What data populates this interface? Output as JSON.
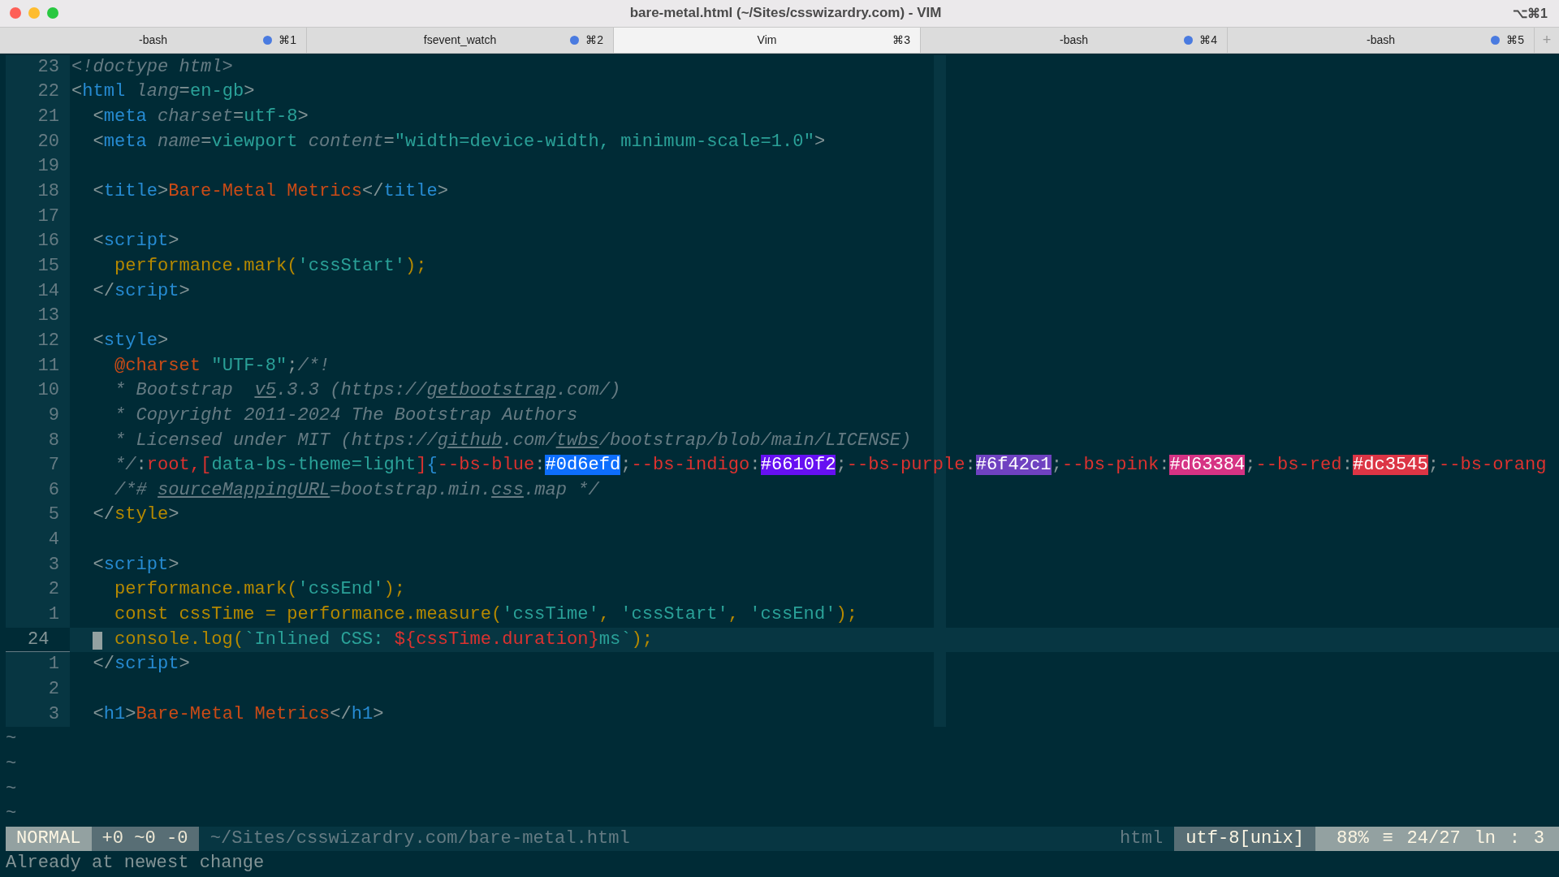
{
  "window": {
    "title": "bare-metal.html (~/Sites/csswizardry.com) - VIM",
    "shortcut": "⌥⌘1"
  },
  "tabs": [
    {
      "label": "-bash",
      "shortcut": "⌘1",
      "activity": true,
      "selected": false
    },
    {
      "label": "fsevent_watch",
      "shortcut": "⌘2",
      "activity": true,
      "selected": false
    },
    {
      "label": "Vim",
      "shortcut": "⌘3",
      "activity": false,
      "selected": true
    },
    {
      "label": "-bash",
      "shortcut": "⌘4",
      "activity": true,
      "selected": false
    },
    {
      "label": "-bash",
      "shortcut": "⌘5",
      "activity": true,
      "selected": false
    }
  ],
  "new_tab": "+",
  "lines": [
    {
      "number": "23",
      "current": false,
      "tokens": [
        {
          "kind": "doctype",
          "text": "<!doctype html>"
        }
      ]
    },
    {
      "number": "22",
      "current": false,
      "tokens": [
        {
          "kind": "punct",
          "text": "<"
        },
        {
          "kind": "tag",
          "text": "html"
        },
        {
          "kind": "attr",
          "text": " lang"
        },
        {
          "kind": "punct",
          "text": "="
        },
        {
          "kind": "value",
          "text": "en-gb"
        },
        {
          "kind": "punct",
          "text": ">"
        }
      ]
    },
    {
      "number": "21",
      "current": false,
      "tokens": [
        {
          "kind": "punct",
          "text": "  <"
        },
        {
          "kind": "tag",
          "text": "meta"
        },
        {
          "kind": "attr",
          "text": " charset"
        },
        {
          "kind": "punct",
          "text": "="
        },
        {
          "kind": "value",
          "text": "utf-8"
        },
        {
          "kind": "punct",
          "text": ">"
        }
      ]
    },
    {
      "number": "20",
      "current": false,
      "tokens": [
        {
          "kind": "punct",
          "text": "  <"
        },
        {
          "kind": "tag",
          "text": "meta"
        },
        {
          "kind": "attr",
          "text": " name"
        },
        {
          "kind": "punct",
          "text": "="
        },
        {
          "kind": "value",
          "text": "viewport"
        },
        {
          "kind": "attr",
          "text": " content"
        },
        {
          "kind": "punct",
          "text": "="
        },
        {
          "kind": "value",
          "text": "\"width=device-width, minimum-scale=1.0\""
        },
        {
          "kind": "punct",
          "text": ">"
        }
      ]
    },
    {
      "number": "19",
      "current": false
    },
    {
      "number": "18",
      "current": false,
      "tokens": [
        {
          "kind": "punct",
          "text": "  <"
        },
        {
          "kind": "tag",
          "text": "title"
        },
        {
          "kind": "punct",
          "text": ">"
        },
        {
          "kind": "text",
          "text": "Bare-Metal Metrics"
        },
        {
          "kind": "punct",
          "text": "</"
        },
        {
          "kind": "tag",
          "text": "title"
        },
        {
          "kind": "punct",
          "text": ">"
        }
      ]
    },
    {
      "number": "17",
      "current": false
    },
    {
      "number": "16",
      "current": false,
      "tokens": [
        {
          "kind": "punct",
          "text": "  <"
        },
        {
          "kind": "tag",
          "text": "script"
        },
        {
          "kind": "punct",
          "text": ">"
        }
      ]
    },
    {
      "number": "15",
      "current": false,
      "tokens": [
        {
          "kind": "call",
          "text": "    performance.mark("
        },
        {
          "kind": "string",
          "text": "'cssStart'"
        },
        {
          "kind": "call",
          "text": ");"
        }
      ]
    },
    {
      "number": "14",
      "current": false,
      "tokens": [
        {
          "kind": "punct",
          "text": "  </"
        },
        {
          "kind": "tag",
          "text": "script"
        },
        {
          "kind": "punct",
          "text": ">"
        }
      ]
    },
    {
      "number": "13",
      "current": false
    },
    {
      "number": "12",
      "current": false,
      "tokens": [
        {
          "kind": "punct",
          "text": "  <"
        },
        {
          "kind": "tag",
          "text": "style"
        },
        {
          "kind": "punct",
          "text": ">"
        }
      ]
    },
    {
      "number": "11",
      "current": false,
      "tokens": [
        {
          "kind": "keyword",
          "text": "    @charset"
        },
        {
          "kind": "string",
          "text": " \"UTF-8\""
        },
        {
          "kind": "punct",
          "text": ";"
        },
        {
          "kind": "comment",
          "text": "/*!"
        }
      ]
    },
    {
      "number": "10",
      "current": false,
      "tokens": [
        {
          "kind": "comment",
          "text": "    * Bootstrap  "
        },
        {
          "kind": "link",
          "text": "v5"
        },
        {
          "kind": "comment",
          "text": ".3.3 (https://"
        },
        {
          "kind": "link",
          "text": "getbootstrap"
        },
        {
          "kind": "comment",
          "text": ".com/)"
        }
      ]
    },
    {
      "number": "9",
      "current": false,
      "tokens": [
        {
          "kind": "comment",
          "text": "    * Copyright 2011-2024 The Bootstrap Authors"
        }
      ]
    },
    {
      "number": "8",
      "current": false,
      "tokens": [
        {
          "kind": "comment",
          "text": "    * Licensed under MIT (https://"
        },
        {
          "kind": "link",
          "text": "github"
        },
        {
          "kind": "comment",
          "text": ".com/"
        },
        {
          "kind": "link",
          "text": "twbs"
        },
        {
          "kind": "comment",
          "text": "/bootstrap/blob/main/LICENSE)"
        }
      ]
    },
    {
      "number": "7",
      "current": false,
      "tokens": [
        {
          "kind": "comment",
          "text": "    */"
        },
        {
          "kind": "punct",
          "text": ":"
        },
        {
          "kind": "selector",
          "text": "root,["
        },
        {
          "kind": "value",
          "text": "data-bs-theme=light"
        },
        {
          "kind": "selector",
          "text": "]"
        },
        {
          "kind": "tag",
          "text": "{"
        },
        {
          "kind": "property",
          "text": "--bs-blue"
        },
        {
          "kind": "punct",
          "text": ":"
        },
        {
          "kind": "swatch",
          "text": "#0d6efd",
          "color": "#0d6efd"
        },
        {
          "kind": "punct",
          "text": ";"
        },
        {
          "kind": "property",
          "text": "--bs-indigo"
        },
        {
          "kind": "punct",
          "text": ":"
        },
        {
          "kind": "swatch",
          "text": "#6610f2",
          "color": "#6610f2"
        },
        {
          "kind": "punct",
          "text": ";"
        },
        {
          "kind": "property",
          "text": "--bs-purple"
        },
        {
          "kind": "punct",
          "text": ":"
        },
        {
          "kind": "swatch",
          "text": "#6f42c1",
          "color": "#6f42c1"
        },
        {
          "kind": "punct",
          "text": ";"
        },
        {
          "kind": "property",
          "text": "--bs-pink"
        },
        {
          "kind": "punct",
          "text": ":"
        },
        {
          "kind": "swatch",
          "text": "#d63384",
          "color": "#d63384"
        },
        {
          "kind": "punct",
          "text": ";"
        },
        {
          "kind": "property",
          "text": "--bs-red"
        },
        {
          "kind": "punct",
          "text": ":"
        },
        {
          "kind": "swatch",
          "text": "#dc3545",
          "color": "#dc3545"
        },
        {
          "kind": "punct",
          "text": ";"
        },
        {
          "kind": "property",
          "text": "--bs-orang"
        }
      ]
    },
    {
      "number": "6",
      "current": false,
      "tokens": [
        {
          "kind": "comment",
          "text": "    /*# "
        },
        {
          "kind": "link",
          "text": "sourceMappingURL"
        },
        {
          "kind": "comment",
          "text": "=bootstrap.min."
        },
        {
          "kind": "link",
          "text": "css"
        },
        {
          "kind": "comment",
          "text": ".map */"
        }
      ]
    },
    {
      "number": "5",
      "current": false,
      "tokens": [
        {
          "kind": "punct",
          "text": "  </"
        },
        {
          "kind": "call",
          "text": "style"
        },
        {
          "kind": "punct",
          "text": ">"
        }
      ]
    },
    {
      "number": "4",
      "current": false
    },
    {
      "number": "3",
      "current": false,
      "tokens": [
        {
          "kind": "punct",
          "text": "  <"
        },
        {
          "kind": "tag",
          "text": "script"
        },
        {
          "kind": "punct",
          "text": ">"
        }
      ]
    },
    {
      "number": "2",
      "current": false,
      "tokens": [
        {
          "kind": "call",
          "text": "    performance.mark("
        },
        {
          "kind": "string",
          "text": "'cssEnd'"
        },
        {
          "kind": "call",
          "text": ");"
        }
      ]
    },
    {
      "number": "1",
      "current": false,
      "tokens": [
        {
          "kind": "call",
          "text": "    const cssTime = performance.measure("
        },
        {
          "kind": "string",
          "text": "'cssTime'"
        },
        {
          "kind": "call",
          "text": ", "
        },
        {
          "kind": "string",
          "text": "'cssStart'"
        },
        {
          "kind": "call",
          "text": ", "
        },
        {
          "kind": "string",
          "text": "'cssEnd'"
        },
        {
          "kind": "call",
          "text": ");"
        }
      ]
    },
    {
      "number": "24",
      "current": true,
      "tokens": [
        {
          "kind": "call",
          "text": "    console.log("
        },
        {
          "kind": "string",
          "text": "`Inlined CSS: "
        },
        {
          "kind": "interp",
          "text": "${cssTime.duration}"
        },
        {
          "kind": "string",
          "text": "ms`"
        },
        {
          "kind": "call",
          "text": ");"
        }
      ]
    },
    {
      "number": "1",
      "current": false,
      "tokens": [
        {
          "kind": "punct",
          "text": "  </"
        },
        {
          "kind": "tag",
          "text": "script"
        },
        {
          "kind": "punct",
          "text": ">"
        }
      ]
    },
    {
      "number": "2",
      "current": false
    },
    {
      "number": "3",
      "current": false,
      "tokens": [
        {
          "kind": "punct",
          "text": "  <"
        },
        {
          "kind": "tag",
          "text": "h1"
        },
        {
          "kind": "punct",
          "text": ">"
        },
        {
          "kind": "text",
          "text": "Bare-Metal Metrics"
        },
        {
          "kind": "punct",
          "text": "</"
        },
        {
          "kind": "tag",
          "text": "h1"
        },
        {
          "kind": "punct",
          "text": ">"
        }
      ]
    }
  ],
  "filler": [
    "~",
    "~",
    "~",
    "~"
  ],
  "status_bar": {
    "mode": "NORMAL",
    "diff": "+0 ~0 -0",
    "path": "~/Sites/csswizardry.com/bare-metal.html",
    "filetype": "html",
    "encoding": "utf-8[unix]",
    "percent": "88%",
    "menu": "≡",
    "position": "24/27",
    "ln": "ln",
    "separator": ":",
    "column": "3"
  },
  "message": "Already at newest change"
}
